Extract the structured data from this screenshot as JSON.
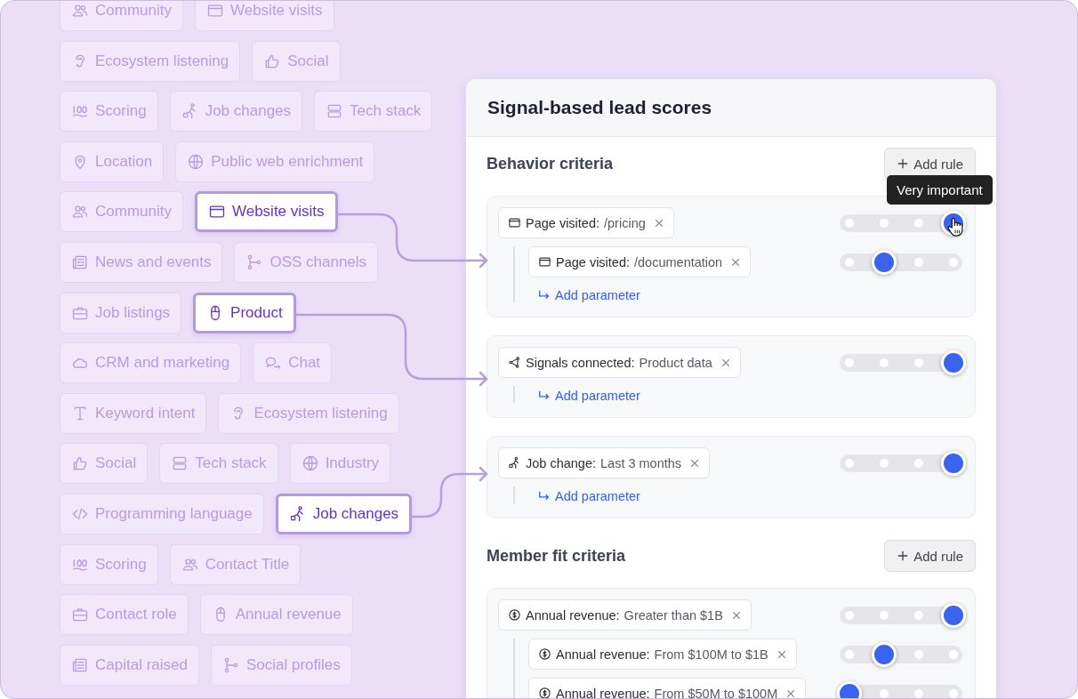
{
  "chip_rows": [
    {
      "chips": [
        {
          "label": "Community",
          "kind": "people",
          "highlighted": false
        },
        {
          "label": "Website visits",
          "kind": "browser",
          "highlighted": false
        }
      ]
    },
    {
      "chips": [
        {
          "label": "Ecosystem listening",
          "kind": "ear",
          "highlighted": false
        },
        {
          "label": "Social",
          "kind": "thumb",
          "highlighted": false
        }
      ]
    },
    {
      "chips": [
        {
          "label": "Scoring",
          "kind": "score",
          "highlighted": false
        },
        {
          "label": "Job changes",
          "kind": "walker",
          "highlighted": false
        },
        {
          "label": "Tech stack",
          "kind": "server",
          "highlighted": false
        }
      ]
    },
    {
      "chips": [
        {
          "label": "Location",
          "kind": "pin",
          "highlighted": false
        },
        {
          "label": "Public web enrichment",
          "kind": "globe",
          "highlighted": false
        }
      ]
    },
    {
      "chips": [
        {
          "label": "Community",
          "kind": "people",
          "highlighted": false
        },
        {
          "label": "Website visits",
          "kind": "browser",
          "highlighted": true
        }
      ]
    },
    {
      "chips": [
        {
          "label": "News and events",
          "kind": "news",
          "highlighted": false
        },
        {
          "label": "OSS channels",
          "kind": "branch",
          "highlighted": false
        }
      ]
    },
    {
      "chips": [
        {
          "label": "Job listings",
          "kind": "case",
          "highlighted": false
        },
        {
          "label": "Product",
          "kind": "mouse",
          "highlighted": true
        }
      ]
    },
    {
      "chips": [
        {
          "label": "CRM and marketing",
          "kind": "cloud",
          "highlighted": false
        },
        {
          "label": "Chat",
          "kind": "chat",
          "highlighted": false
        }
      ]
    },
    {
      "chips": [
        {
          "label": "Keyword intent",
          "kind": "type",
          "highlighted": false
        },
        {
          "label": "Ecosystem listening",
          "kind": "ear",
          "highlighted": false
        }
      ]
    },
    {
      "chips": [
        {
          "label": "Social",
          "kind": "thumb",
          "highlighted": false
        },
        {
          "label": "Tech stack",
          "kind": "server",
          "highlighted": false
        },
        {
          "label": "Industry",
          "kind": "globe",
          "highlighted": false
        }
      ]
    },
    {
      "chips": [
        {
          "label": "Programming language",
          "kind": "code",
          "highlighted": false
        },
        {
          "label": "Job changes",
          "kind": "walker",
          "highlighted": true
        }
      ]
    },
    {
      "chips": [
        {
          "label": "Scoring",
          "kind": "score",
          "highlighted": false
        },
        {
          "label": "Contact Title",
          "kind": "people",
          "highlighted": false
        }
      ]
    },
    {
      "chips": [
        {
          "label": "Contact role",
          "kind": "case",
          "highlighted": false
        },
        {
          "label": "Annual revenue",
          "kind": "mouse",
          "highlighted": false
        }
      ]
    },
    {
      "chips": [
        {
          "label": "Capital raised",
          "kind": "news",
          "highlighted": false
        },
        {
          "label": "Social profiles",
          "kind": "branch",
          "highlighted": false
        }
      ]
    }
  ],
  "panel": {
    "title": "Signal-based lead scores",
    "tooltip": "Very important",
    "sections": [
      {
        "heading": "Behavior criteria",
        "add_button": "Add rule",
        "rules": [
          {
            "label": "Page visited:",
            "value": "/pricing",
            "kind": "browser",
            "level": 1,
            "children": [
              {
                "label": "Page visited:",
                "value": "/documentation",
                "kind": "browser",
                "level": 0.33
              }
            ],
            "add_link": "Add parameter"
          },
          {
            "label": "Signals connected:",
            "value": "Product data",
            "kind": "share",
            "level": 1,
            "add_link": "Add parameter"
          },
          {
            "label": "Job change:",
            "value": "Last 3 months",
            "kind": "walker",
            "level": 1,
            "add_link": "Add parameter"
          }
        ]
      },
      {
        "heading": "Member fit criteria",
        "add_button": "Add rule",
        "rules": [
          {
            "label": "Annual revenue:",
            "value": "Greater than $1B",
            "kind": "dollar",
            "level": 1,
            "children": [
              {
                "label": "Annual revenue:",
                "value": "From $100M to $1B",
                "kind": "dollar",
                "level": 0.33
              },
              {
                "label": "Annual revenue:",
                "value": "From $50M to $100M",
                "kind": "dollar",
                "level": 0
              }
            ]
          }
        ]
      }
    ]
  }
}
